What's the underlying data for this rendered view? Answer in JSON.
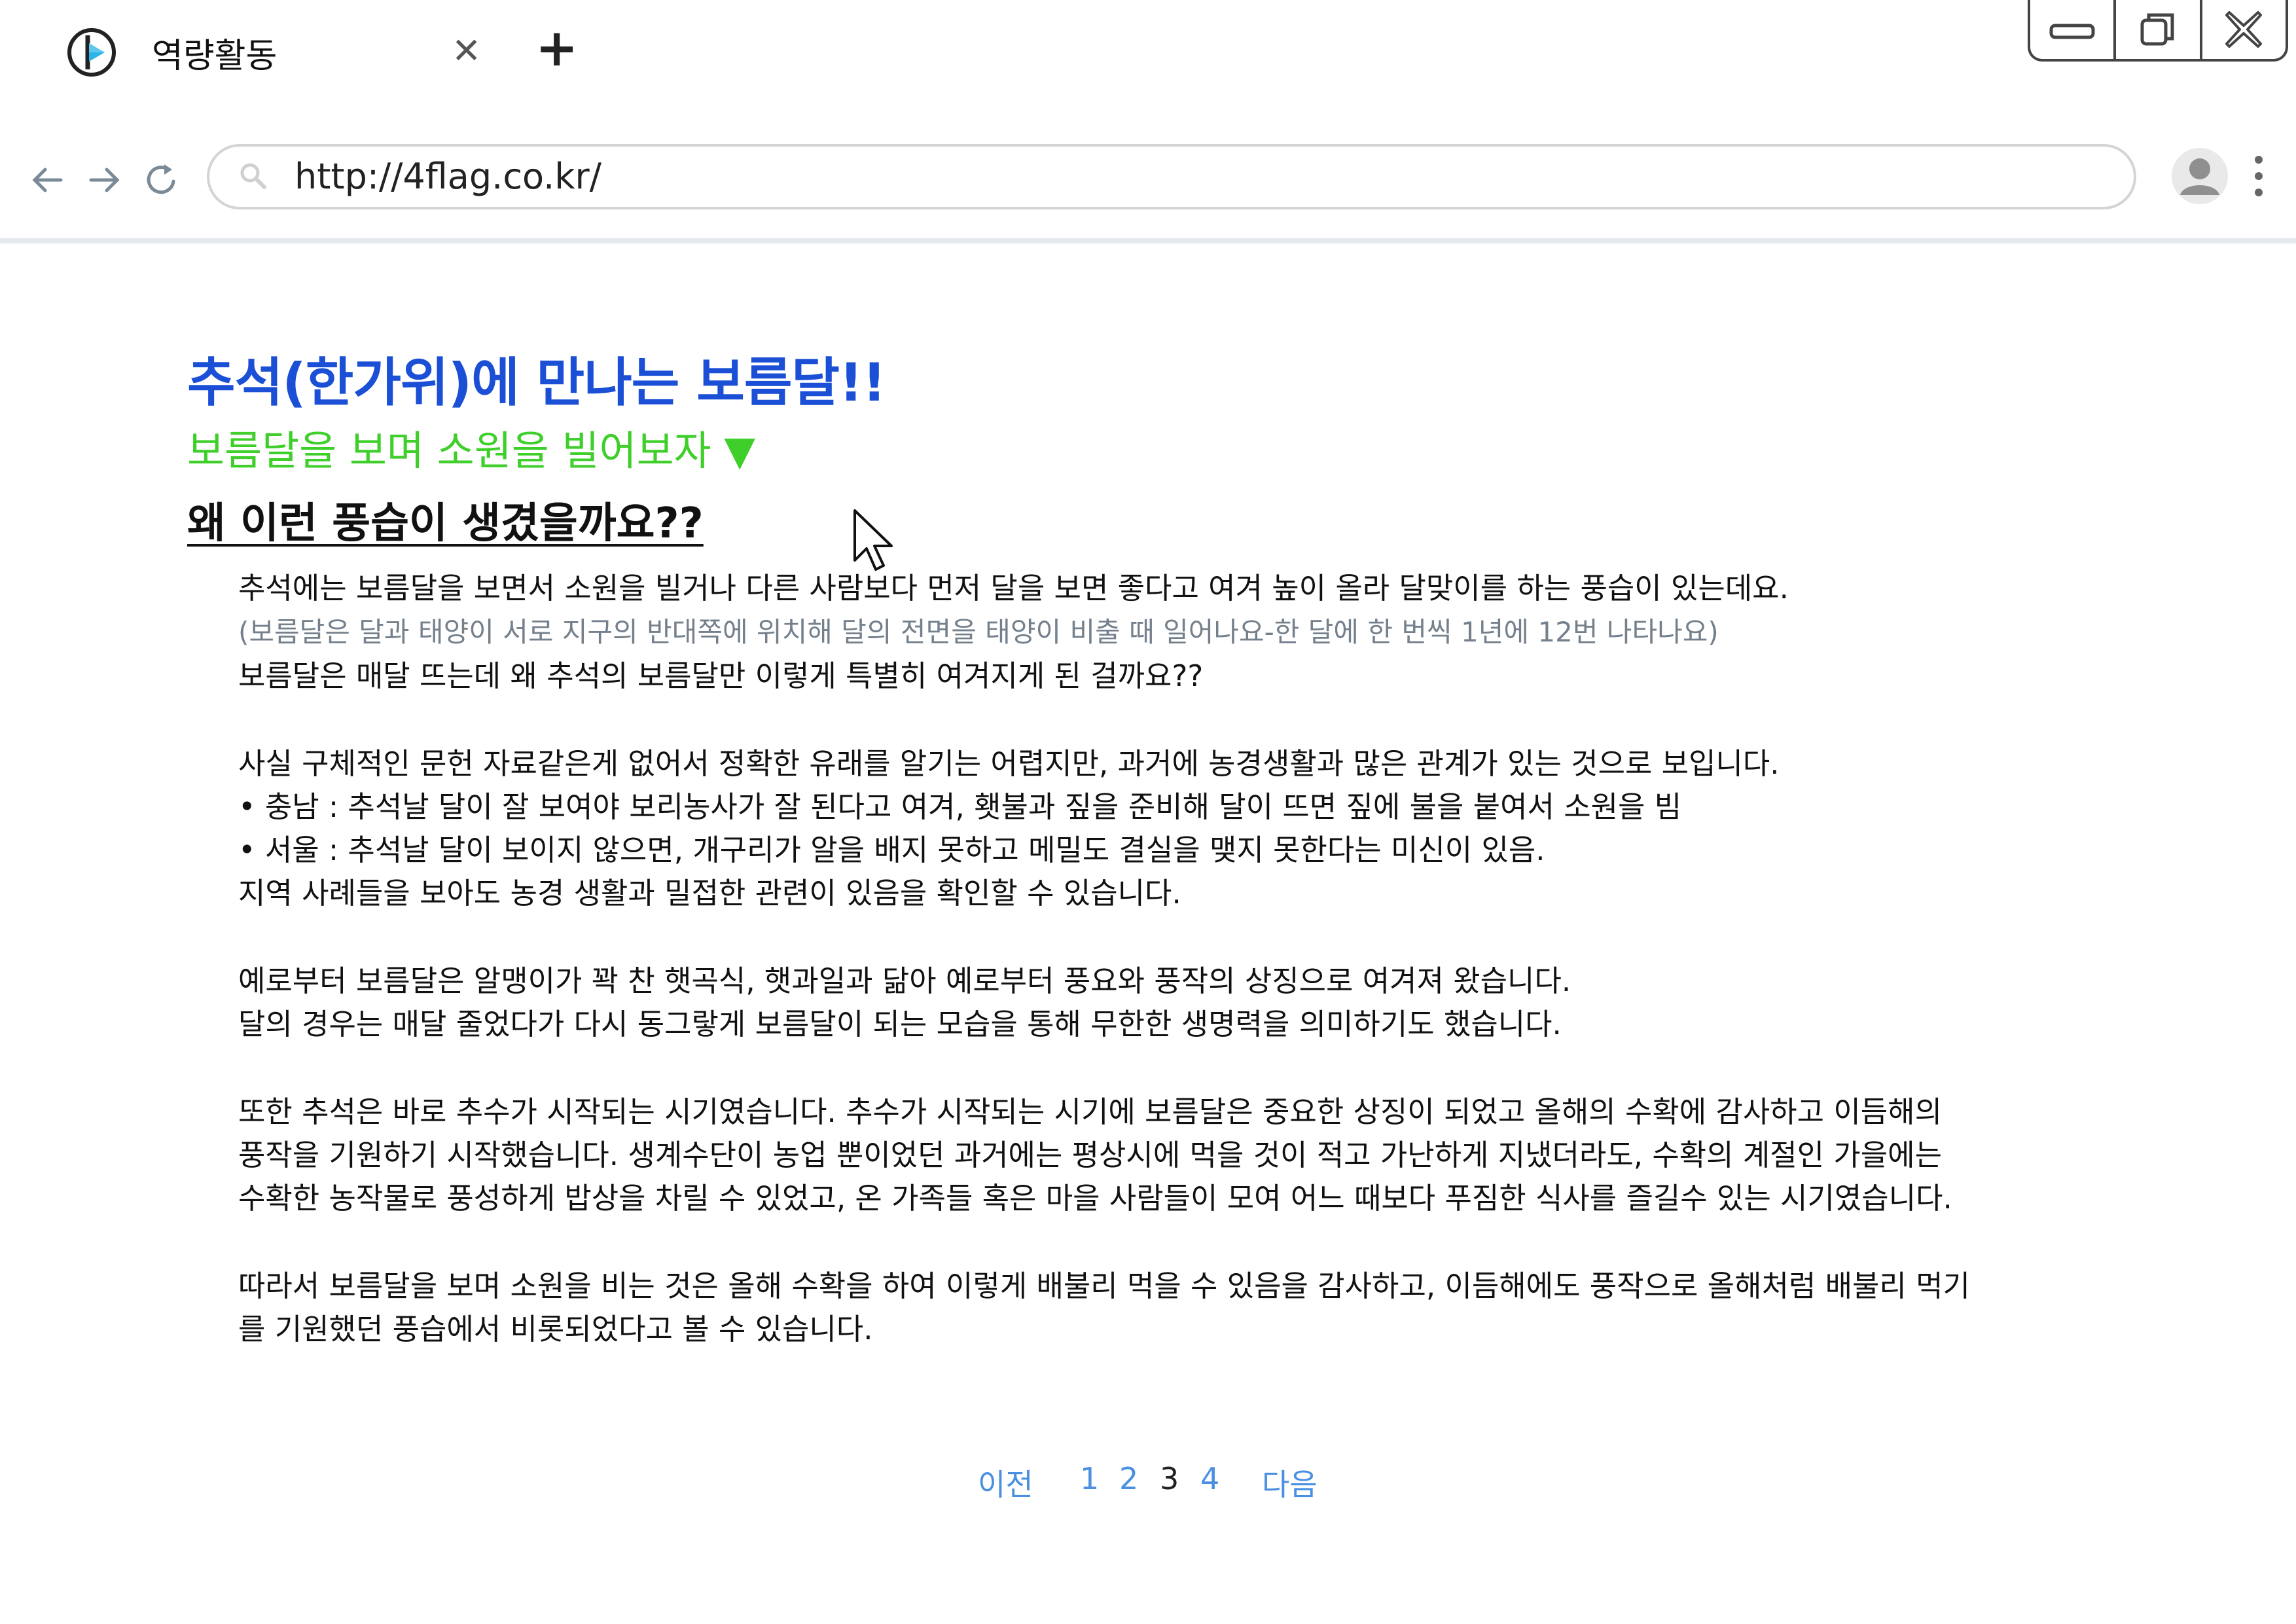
{
  "browser": {
    "tab_title": "역량활동",
    "url": "http://4flag.co.kr/"
  },
  "article": {
    "title": "추석(한가위)에 만나는 보름달!!",
    "subtitle": "보름달을 보며 소원을 빌어보자 ▼",
    "question": "왜 이런 풍습이 생겼을까요??",
    "lines": [
      "추석에는 보름달을 보면서 소원을 빌거나 다른 사람보다 먼저 달을 보면 좋다고 여겨 높이 올라 달맞이를 하는 풍습이 있는데요.",
      "(보름달은 달과 태양이 서로 지구의 반대쪽에 위치해 달의 전면을 태양이 비출 때 일어나요-한 달에 한 번씩 1년에 12번 나타나요)",
      "보름달은 매달 뜨는데 왜 추석의 보름달만 이렇게 특별히 여겨지게 된 걸까요??",
      " 사실 구체적인 문헌 자료같은게 없어서 정확한 유래를 알기는 어렵지만, 과거에 농경생활과 많은 관계가 있는 것으로 보입니다.",
      " • 충남 : 추석날 달이 잘 보여야 보리농사가 잘 된다고 여겨, 횃불과 짚을 준비해 달이 뜨면 짚에 불을 붙여서 소원을 빔",
      " • 서울 : 추석날 달이 보이지 않으면, 개구리가 알을 배지 못하고 메밀도 결실을 맺지 못한다는 미신이 있음.",
      "지역 사례들을 보아도 농경 생활과 밀접한 관련이 있음을 확인할 수 있습니다.",
      " 예로부터 보름달은 알맹이가 꽉 찬 햇곡식, 햇과일과 닮아 예로부터 풍요와 풍작의 상징으로 여겨져 왔습니다.",
      "달의 경우는 매달 줄었다가 다시 동그랗게 보름달이 되는 모습을 통해 무한한 생명력을 의미하기도 했습니다.",
      " 또한 추석은 바로 추수가 시작되는 시기였습니다. 추수가 시작되는 시기에 보름달은 중요한 상징이 되었고 올해의 수확에 감사하고 이듬해의",
      "풍작을 기원하기 시작했습니다. 생계수단이 농업 뿐이었던 과거에는 평상시에 먹을 것이 적고 가난하게 지냈더라도, 수확의 계절인 가을에는",
      "수확한 농작물로 풍성하게 밥상을 차릴 수 있었고, 온 가족들 혹은 마을 사람들이 모여 어느 때보다 푸짐한 식사를 즐길수 있는 시기였습니다.",
      " 따라서 보름달을 보며 소원을 비는 것은 올해 수확을 하여 이렇게 배불리 먹을 수 있음을 감사하고, 이듬해에도 풍작으로 올해처럼 배불리 먹기",
      "를 기원했던 풍습에서 비롯되었다고 볼 수 있습니다."
    ]
  },
  "pagination": {
    "prev": "이전",
    "pages": [
      "1",
      "2",
      "3",
      "4"
    ],
    "current": "3",
    "next": "다음"
  },
  "icons": {
    "tab_logo": "play-logo-icon",
    "close_tab": "close-icon",
    "new_tab": "plus-icon",
    "minimize": "minimize-icon",
    "restore": "restore-icon",
    "close_window": "close-window-icon",
    "back": "arrow-left-icon",
    "forward": "arrow-right-icon",
    "reload": "reload-icon",
    "search": "search-icon",
    "profile": "avatar-icon",
    "menu": "kebab-menu-icon"
  },
  "colors": {
    "title": "#1a4fd6",
    "subtitle": "#3ecf2a",
    "gray_text": "#74808c",
    "link": "#4a8fe0"
  }
}
